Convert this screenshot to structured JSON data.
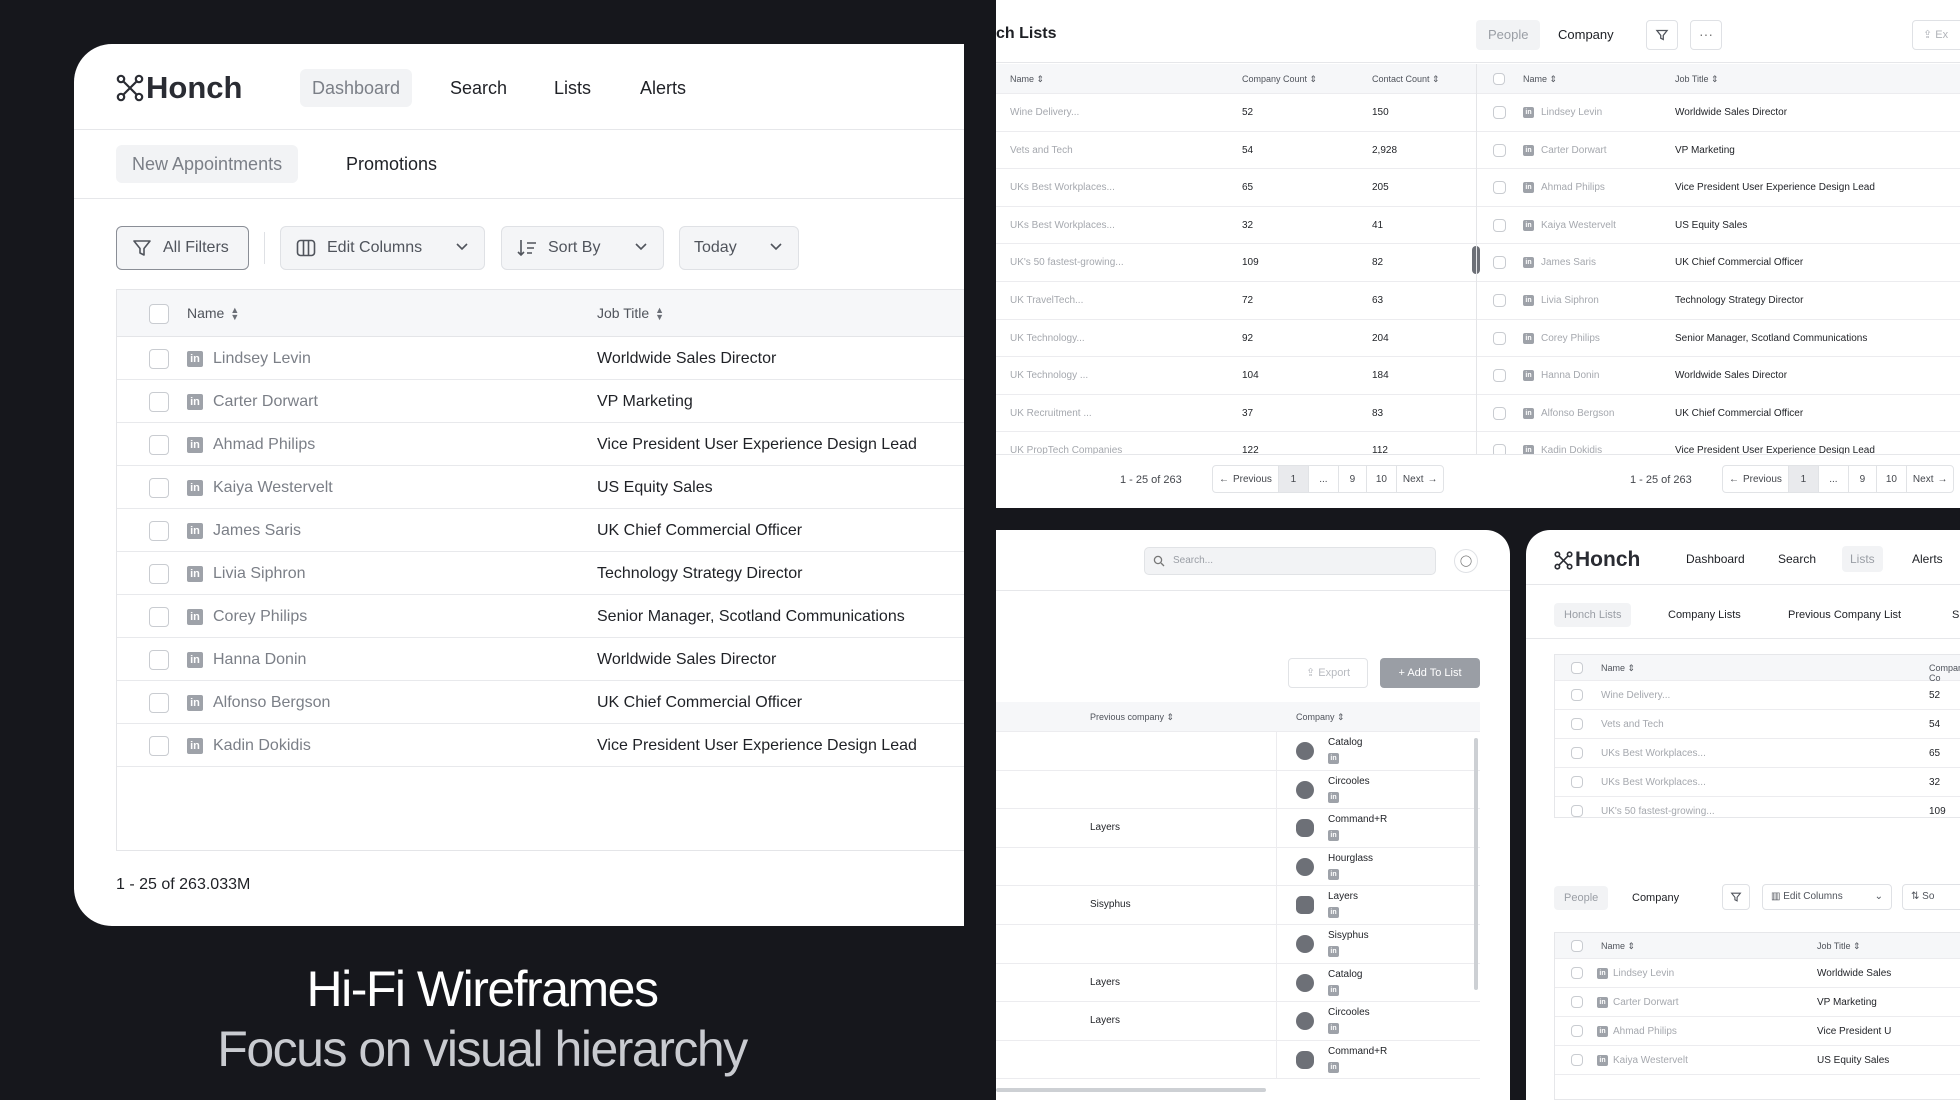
{
  "main": {
    "logo_text": "Honch",
    "nav": [
      "Dashboard",
      "Search",
      "Lists",
      "Alerts"
    ],
    "tabs": [
      "New Appointments",
      "Promotions"
    ],
    "filters": {
      "all": "All Filters",
      "edit": "Edit Columns",
      "sort": "Sort By",
      "date": "Today"
    },
    "columns": [
      "Name",
      "Job Title"
    ],
    "rows": [
      {
        "name": "Lindsey Levin",
        "title": "Worldwide Sales Director"
      },
      {
        "name": "Carter Dorwart",
        "title": "VP Marketing"
      },
      {
        "name": "Ahmad Philips",
        "title": "Vice President User Experience Design Lead"
      },
      {
        "name": "Kaiya Westervelt",
        "title": "US Equity Sales"
      },
      {
        "name": "James Saris",
        "title": "UK Chief Commercial Officer"
      },
      {
        "name": "Livia Siphron",
        "title": "Technology Strategy Director"
      },
      {
        "name": "Corey Philips",
        "title": "Senior Manager, Scotland Communications"
      },
      {
        "name": "Hanna Donin",
        "title": "Worldwide Sales Director"
      },
      {
        "name": "Alfonso Bergson",
        "title": "UK Chief Commercial Officer"
      },
      {
        "name": "Kadin Dokidis",
        "title": "Vice President User Experience Design Lead"
      }
    ],
    "footer": "1 - 25 of 263.033M"
  },
  "caption": {
    "line1": "Hi-Fi Wireframes",
    "line2": "Focus on visual hierarchy"
  },
  "topright": {
    "title": "ch Lists",
    "seg": [
      "People",
      "Company"
    ],
    "export_label": "Ex",
    "left_cols": [
      "Name",
      "Company Count",
      "Contact Count"
    ],
    "left_rows": [
      [
        "Wine Delivery...",
        "52",
        "150"
      ],
      [
        "Vets and Tech",
        "54",
        "2,928"
      ],
      [
        "UKs Best Workplaces...",
        "65",
        "205"
      ],
      [
        "UKs Best Workplaces...",
        "32",
        "41"
      ],
      [
        "UK's 50 fastest-growing...",
        "109",
        "82"
      ],
      [
        "UK TravelTech...",
        "72",
        "63"
      ],
      [
        "UK Technology...",
        "92",
        "204"
      ],
      [
        "UK Technology ...",
        "104",
        "184"
      ],
      [
        "UK Recruitment ...",
        "37",
        "83"
      ],
      [
        "UK PropTech Companies",
        "122",
        "112"
      ]
    ],
    "right_cols": [
      "Name",
      "Job Title"
    ],
    "right_rows": [
      [
        "Lindsey Levin",
        "Worldwide Sales Director"
      ],
      [
        "Carter Dorwart",
        "VP Marketing"
      ],
      [
        "Ahmad Philips",
        "Vice President User Experience Design Lead"
      ],
      [
        "Kaiya Westervelt",
        "US Equity Sales"
      ],
      [
        "James Saris",
        "UK Chief Commercial Officer"
      ],
      [
        "Livia Siphron",
        "Technology Strategy Director"
      ],
      [
        "Corey Philips",
        "Senior Manager, Scotland Communications"
      ],
      [
        "Hanna Donin",
        "Worldwide Sales Director"
      ],
      [
        "Alfonso Bergson",
        "UK Chief Commercial Officer"
      ],
      [
        "Kadin Dokidis",
        "Vice President User Experience Design Lead"
      ]
    ],
    "count": "1 - 25 of 263",
    "pager": [
      "Previous",
      "1",
      "...",
      "9",
      "10",
      "Next"
    ]
  },
  "bottomleft": {
    "search_placeholder": "Search...",
    "export": "Export",
    "add": "Add To List",
    "cols": [
      "Previous company",
      "Company"
    ],
    "rows": [
      {
        "prev": "",
        "company": "Catalog"
      },
      {
        "prev": "",
        "company": "Circooles"
      },
      {
        "prev": "Layers",
        "company": "Command+R"
      },
      {
        "prev": "",
        "company": "Hourglass"
      },
      {
        "prev": "Sisyphus",
        "company": "Layers"
      },
      {
        "prev": "",
        "company": "Sisyphus"
      },
      {
        "prev": "Layers",
        "company": "Catalog"
      },
      {
        "prev": "Layers",
        "company": "Circooles"
      },
      {
        "prev": "",
        "company": "Command+R"
      }
    ]
  },
  "bottomright": {
    "logo_text": "Honch",
    "nav": [
      "Dashboard",
      "Search",
      "Lists",
      "Alerts"
    ],
    "tabs": [
      "Honch Lists",
      "Company Lists",
      "Previous Company List",
      "S"
    ],
    "list_cols": [
      "Name",
      "Company Co"
    ],
    "list_rows": [
      [
        "Wine Delivery...",
        "52"
      ],
      [
        "Vets and Tech",
        "54"
      ],
      [
        "UKs Best Workplaces...",
        "65"
      ],
      [
        "UKs Best Workplaces...",
        "32"
      ],
      [
        "UK's 50 fastest-growing...",
        "109"
      ]
    ],
    "seg": [
      "People",
      "Company"
    ],
    "edit": "Edit Columns",
    "sort": "So",
    "people_cols": [
      "Name",
      "Job Title"
    ],
    "people_rows": [
      [
        "Lindsey Levin",
        "Worldwide Sales"
      ],
      [
        "Carter Dorwart",
        "VP Marketing"
      ],
      [
        "Ahmad Philips",
        "Vice President U"
      ],
      [
        "Kaiya Westervelt",
        "US Equity Sales"
      ]
    ]
  }
}
